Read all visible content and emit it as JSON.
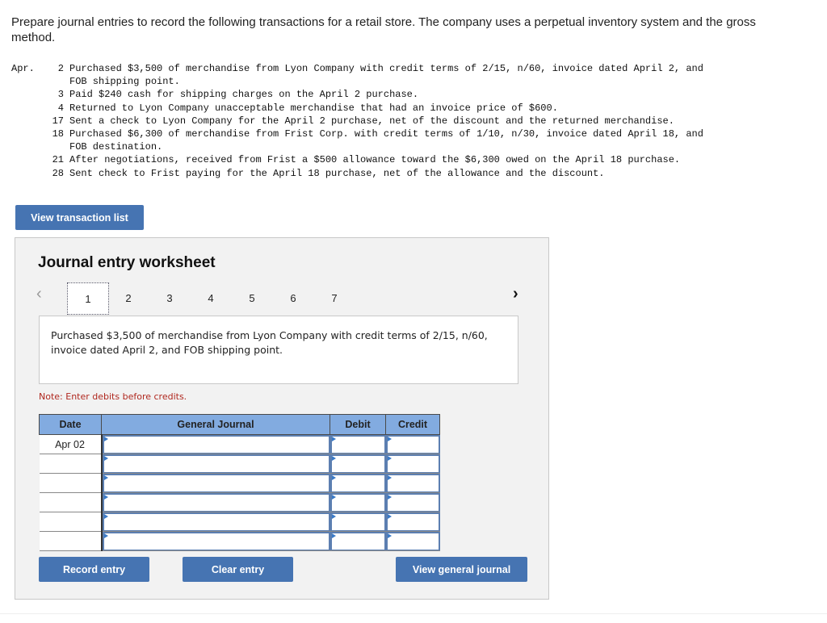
{
  "intro": "Prepare journal entries to record the following transactions for a retail store. The company uses a perpetual inventory system and the gross method.",
  "transactions": [
    {
      "month": "Apr.",
      "day": "2",
      "text": "Purchased $3,500 of merchandise from Lyon Company with credit terms of 2/15, n/60, invoice dated April 2, and\nFOB shipping point."
    },
    {
      "month": "",
      "day": "3",
      "text": "Paid $240 cash for shipping charges on the April 2 purchase."
    },
    {
      "month": "",
      "day": "4",
      "text": "Returned to Lyon Company unacceptable merchandise that had an invoice price of $600."
    },
    {
      "month": "",
      "day": "17",
      "text": "Sent a check to Lyon Company for the April 2 purchase, net of the discount and the returned merchandise."
    },
    {
      "month": "",
      "day": "18",
      "text": "Purchased $6,300 of merchandise from Frist Corp. with credit terms of 1/10, n/30, invoice dated April 18, and\nFOB destination."
    },
    {
      "month": "",
      "day": "21",
      "text": "After negotiations, received from Frist a $500 allowance toward the $6,300 owed on the April 18 purchase."
    },
    {
      "month": "",
      "day": "28",
      "text": "Sent check to Frist paying for the April 18 purchase, net of the allowance and the discount."
    }
  ],
  "buttons": {
    "view_transaction_list": "View transaction list",
    "record_entry": "Record entry",
    "clear_entry": "Clear entry",
    "view_general_journal": "View general journal"
  },
  "worksheet": {
    "title": "Journal entry worksheet",
    "prev_icon": "‹",
    "next_icon": "›",
    "pages": [
      "1",
      "2",
      "3",
      "4",
      "5",
      "6",
      "7"
    ],
    "active_page": "1",
    "description": "Purchased $3,500 of merchandise from Lyon Company with credit terms of 2/15, n/60, invoice dated April 2, and FOB shipping point.",
    "note": "Note: Enter debits before credits."
  },
  "journal_table": {
    "headers": [
      "Date",
      "General Journal",
      "Debit",
      "Credit"
    ],
    "rows": [
      {
        "date": "Apr 02",
        "account": "",
        "debit": "",
        "credit": ""
      },
      {
        "date": "",
        "account": "",
        "debit": "",
        "credit": ""
      },
      {
        "date": "",
        "account": "",
        "debit": "",
        "credit": ""
      },
      {
        "date": "",
        "account": "",
        "debit": "",
        "credit": ""
      },
      {
        "date": "",
        "account": "",
        "debit": "",
        "credit": ""
      },
      {
        "date": "",
        "account": "",
        "debit": "",
        "credit": ""
      }
    ]
  },
  "colors": {
    "button": "#4674b2",
    "header": "#82abe0",
    "note": "#b0281f"
  }
}
